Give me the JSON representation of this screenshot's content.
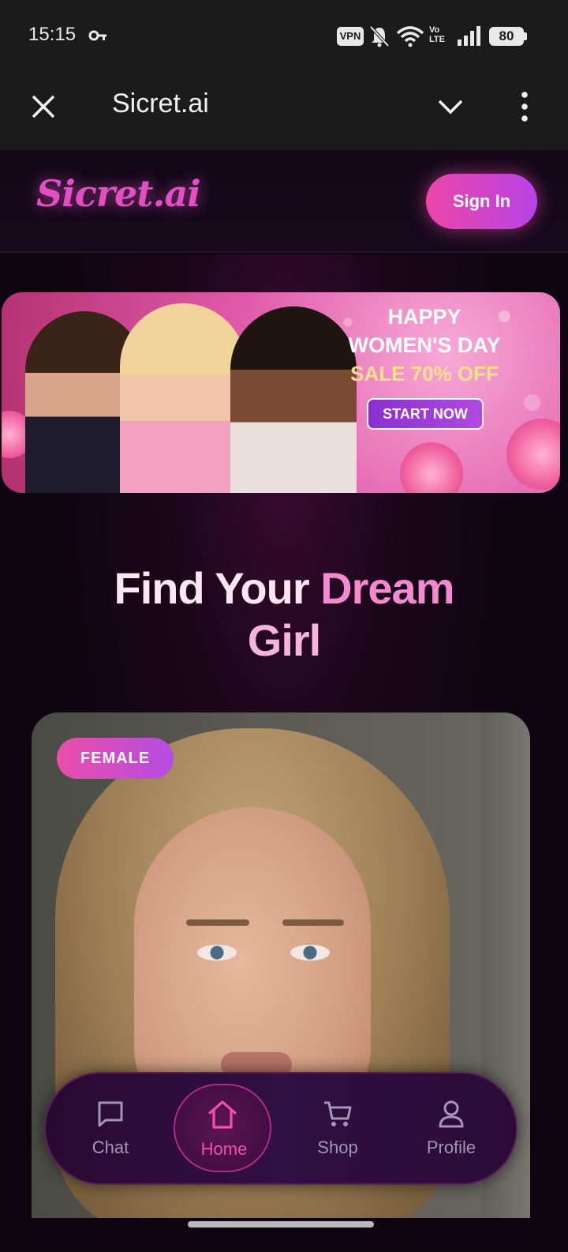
{
  "status_bar": {
    "time": "15:15",
    "vpn": "VPN",
    "volte_top": "Vo",
    "volte_bottom": "LTE",
    "battery": "80"
  },
  "browser": {
    "title": "Sicret.ai"
  },
  "header": {
    "logo": "Sicret.ai",
    "sign_in": "Sign In"
  },
  "banner": {
    "line1": "HAPPY",
    "line2": "WOMEN'S DAY",
    "line3": "SALE 70% OFF",
    "cta": "START NOW"
  },
  "hero": {
    "part1": "Find Your ",
    "part2": "Dream",
    "part3": "Girl"
  },
  "card": {
    "badge": "FEMALE"
  },
  "nav": [
    {
      "label": "Chat",
      "icon": "chat-bubble-icon"
    },
    {
      "label": "Home",
      "icon": "home-icon",
      "active": true
    },
    {
      "label": "Shop",
      "icon": "cart-icon"
    },
    {
      "label": "Profile",
      "icon": "user-icon"
    }
  ],
  "colors": {
    "accent_pink": "#ec46a8",
    "accent_purple": "#b743e6",
    "background": "#0d0610",
    "banner_yellow": "#ffe08a"
  }
}
